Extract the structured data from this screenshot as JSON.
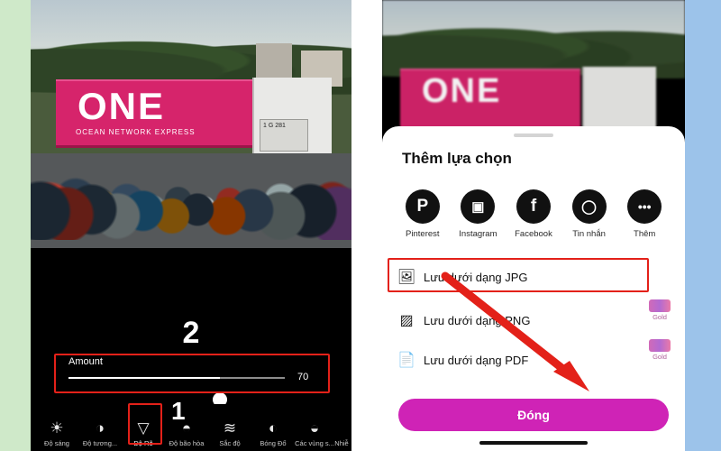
{
  "left_phone": {
    "step_number": "2",
    "editor": {
      "slider_label": "Amount",
      "slider_value": "70",
      "slider_percent": 70
    },
    "toolbar": [
      {
        "label": "Độ sáng",
        "icon": "brightness-icon",
        "active": false
      },
      {
        "label": "Độ tương...",
        "icon": "contrast-icon",
        "active": false
      },
      {
        "label": "Độ Rõ",
        "icon": "clarity-icon",
        "active": true
      },
      {
        "label": "Độ bão hòa",
        "icon": "saturation-icon",
        "active": false
      },
      {
        "label": "Sắc độ",
        "icon": "hue-icon",
        "active": false
      },
      {
        "label": "Bóng Đổ",
        "icon": "shadow-icon",
        "active": false
      },
      {
        "label": "Các vùng s...",
        "icon": "highlights-icon",
        "active": false
      },
      {
        "label": "Nhiễ",
        "icon": "noise-icon",
        "active": false
      }
    ],
    "callout_number": "1",
    "photo": {
      "container_text": "ONE",
      "container_subtext": "OCEAN NETWORK EXPRESS",
      "truck_plate": "1 G 281"
    }
  },
  "right_phone": {
    "sheet_title": "Thêm lựa chọn",
    "share_targets": [
      {
        "label": "Pinterest",
        "icon": "pinterest-icon",
        "glyph": "P",
        "color": "#111111"
      },
      {
        "label": "Instagram",
        "icon": "instagram-icon",
        "glyph": "◙",
        "color": "#111111"
      },
      {
        "label": "Facebook",
        "icon": "facebook-icon",
        "glyph": "f",
        "color": "#111111"
      },
      {
        "label": "Tin nhắn",
        "icon": "messages-icon",
        "glyph": "💬",
        "color": "#111111"
      },
      {
        "label": "Thêm",
        "icon": "more-dots-icon",
        "glyph": "•••",
        "color": "#111111"
      }
    ],
    "save_options": [
      {
        "label": "Lưu dưới dạng JPG",
        "icon": "image-file-icon",
        "badge": null
      },
      {
        "label": "Lưu dưới dạng PNG",
        "icon": "png-file-icon",
        "badge": "Gold"
      },
      {
        "label": "Lưu dưới dạng PDF",
        "icon": "pdf-file-icon",
        "badge": "Gold"
      }
    ],
    "close_button": "Đóng"
  },
  "annotations": {
    "highlight_color": "#e32119",
    "arrow": "red-arrow-pointing-to-close-button"
  }
}
